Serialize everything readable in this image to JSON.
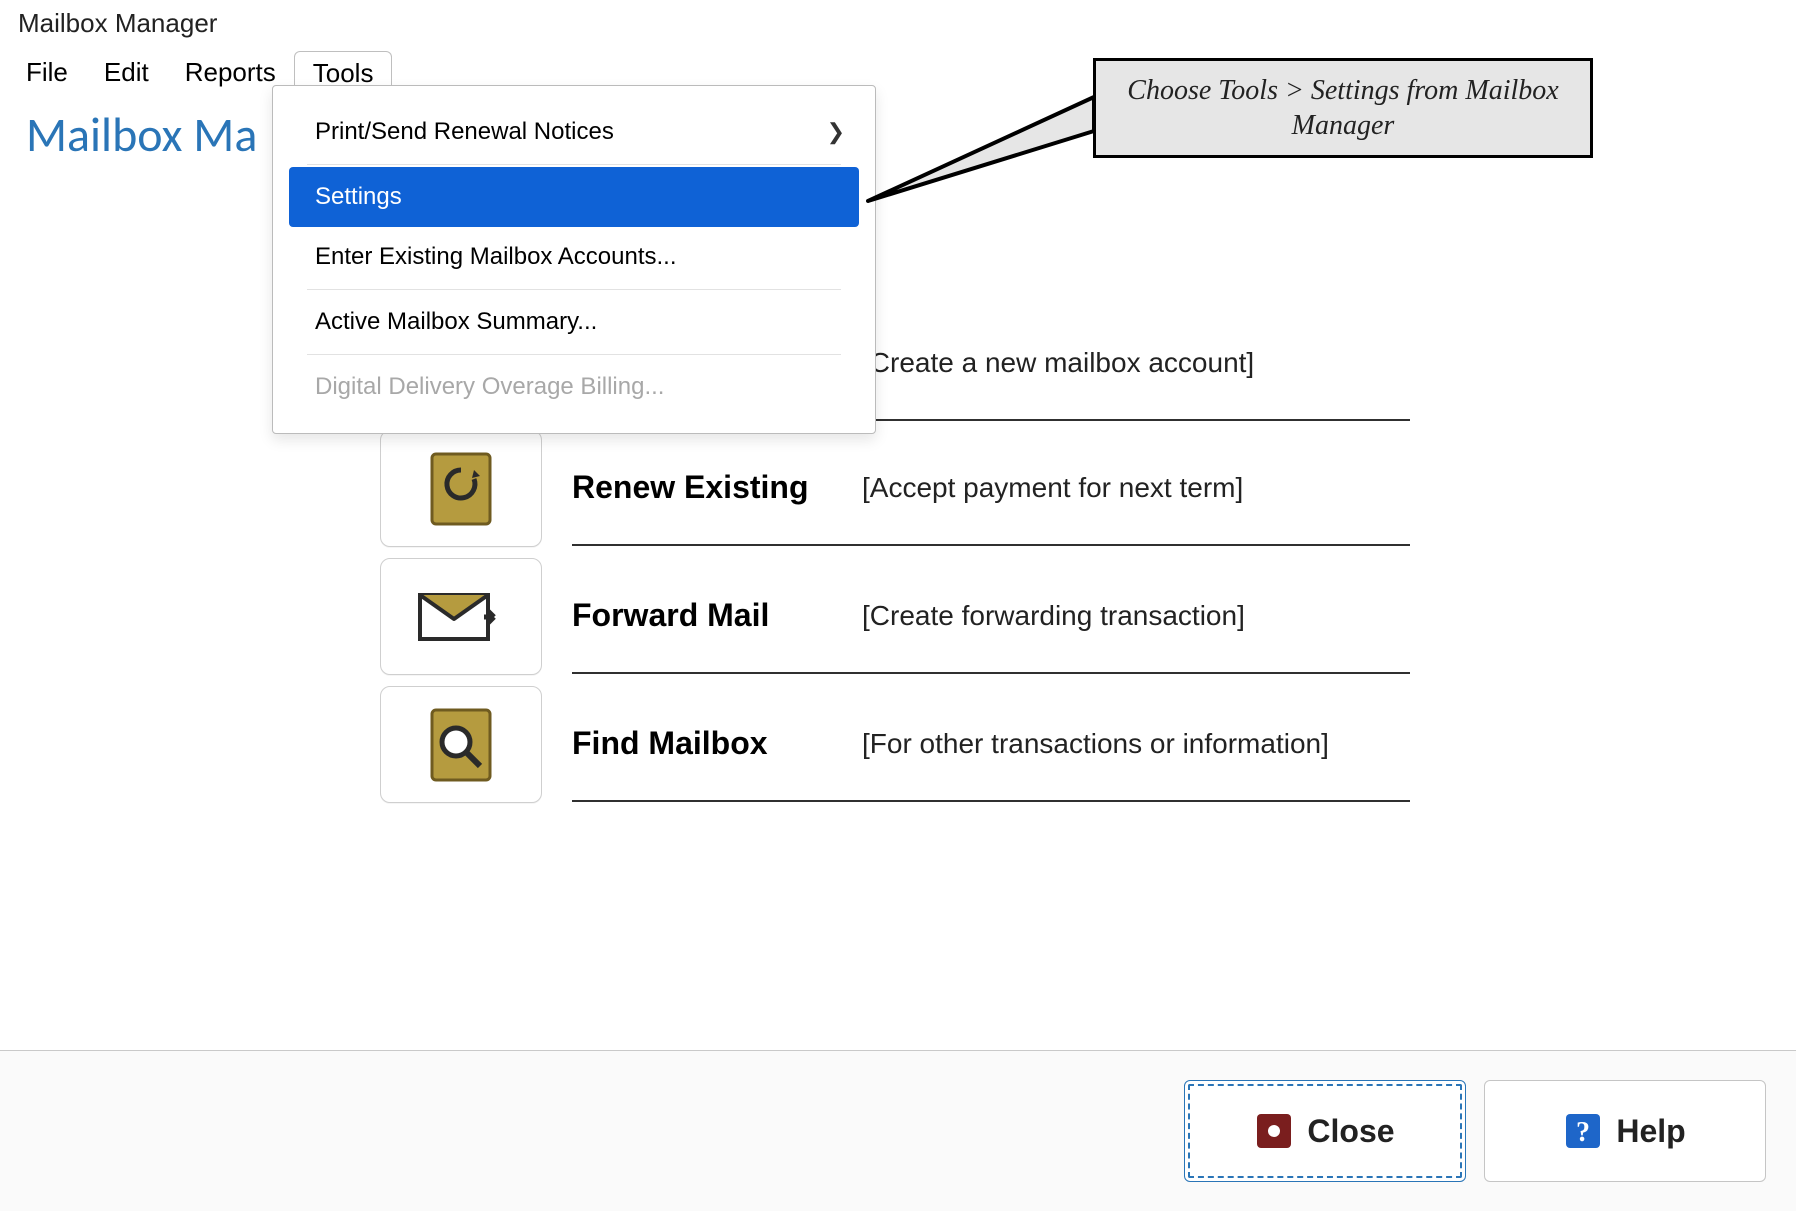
{
  "window": {
    "title": "Mailbox Manager"
  },
  "menubar": {
    "items": [
      "File",
      "Edit",
      "Reports",
      "Tools"
    ],
    "active_index": 3
  },
  "page_title": "Mailbox Ma",
  "dropdown": {
    "items": [
      {
        "label": "Print/Send Renewal Notices",
        "submenu": true
      },
      {
        "label": "Settings",
        "selected": true
      },
      {
        "label": "Enter Existing Mailbox Accounts..."
      },
      {
        "label": "Active Mailbox Summary..."
      },
      {
        "label": "Digital Delivery Overage Billing...",
        "disabled": true
      }
    ]
  },
  "actions": [
    {
      "title": "",
      "desc": "[Create a new mailbox account]"
    },
    {
      "title": "Renew Existing",
      "desc": "[Accept payment for next term]"
    },
    {
      "title": "Forward Mail",
      "desc": "[Create forwarding transaction]"
    },
    {
      "title": "Find Mailbox",
      "desc": "[For other transactions or information]"
    }
  ],
  "footer": {
    "close": "Close",
    "help": "Help"
  },
  "callout": "Choose Tools > Settings from Mailbox Manager"
}
